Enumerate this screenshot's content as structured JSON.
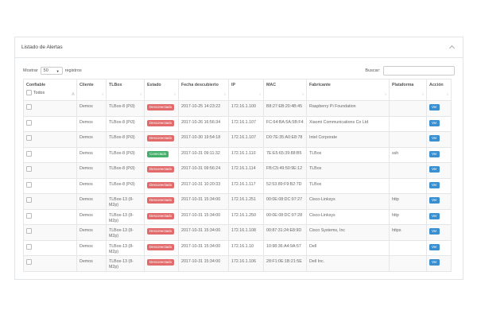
{
  "panel": {
    "title": "Listado de Alertas"
  },
  "controls": {
    "show_label": "Mostrar",
    "page_size": "50",
    "records_label": "registros",
    "search_label": "Buscar:"
  },
  "table": {
    "headers": {
      "trusted": "Confiable",
      "all": "Todos",
      "client": "Cliente",
      "tlbox": "TLBox",
      "status": "Estado",
      "discovered": "Fecha descubierto",
      "ip": "IP",
      "mac": "MAC",
      "maker": "Fabricante",
      "platform": "Plataforma",
      "action": "Acción"
    },
    "rows": [
      {
        "client": "Demos",
        "tlbox": "TLBox-8 (Pi3)",
        "status": "Desconectado",
        "status_kind": "red",
        "date": "2017-10-25 14:23:22",
        "ip": "172.16.1.100",
        "mac": "B8:27:EB:20:4B:45",
        "maker": "Raspberry Pi Foundation",
        "platform": "",
        "action": "Ver"
      },
      {
        "client": "Demos",
        "tlbox": "TLBox-8 (Pi3)",
        "status": "Desconectado",
        "status_kind": "red",
        "date": "2017-10-26 16:56:34",
        "ip": "172.16.1.107",
        "mac": "FC:64:BA:5A:5B:F4",
        "maker": "Xiaomi Communications Co Ltd",
        "platform": "",
        "action": "Ver"
      },
      {
        "client": "Demos",
        "tlbox": "TLBox-8 (Pi3)",
        "status": "Desconectado",
        "status_kind": "red",
        "date": "2017-10-30 19:54:18",
        "ip": "172.16.1.107",
        "mac": "D0:7E:35:A0:E8:78",
        "maker": "Intel Corporate",
        "platform": "",
        "action": "Ver"
      },
      {
        "client": "Demos",
        "tlbox": "TLBox-8 (Pi3)",
        "status": "Conectado",
        "status_kind": "green",
        "date": "2017-10-31 09:11:32",
        "ip": "172.16.1.110",
        "mac": "7E:E5:65:39:88:B5",
        "maker": "TLBox",
        "platform": "ssh",
        "action": "Ver"
      },
      {
        "client": "Demos",
        "tlbox": "TLBox-8 (Pi3)",
        "status": "Desconectado",
        "status_kind": "red",
        "date": "2017-10-31 09:56:24",
        "ip": "172.16.1.114",
        "mac": "FB:C5:49:50:9E:12",
        "maker": "TLBox",
        "platform": "",
        "action": "Ver"
      },
      {
        "client": "Demos",
        "tlbox": "TLBox-8 (Pi3)",
        "status": "Desconectado",
        "status_kind": "red",
        "date": "2017-10-31 10:20:33",
        "ip": "172.16.1.117",
        "mac": "52:53:89:F9:B2:7D",
        "maker": "TLBox",
        "platform": "",
        "action": "Ver"
      },
      {
        "client": "Demos",
        "tlbox": "TLBox-13 (8-M2p)",
        "status": "Desconectado",
        "status_kind": "red",
        "date": "2017-10-31 15:34:00",
        "ip": "172.16.1.251",
        "mac": "00:0E:08:DC:97:27",
        "maker": "Cisco-Linksys",
        "platform": "http",
        "action": "Ver"
      },
      {
        "client": "Demos",
        "tlbox": "TLBox-13 (8-M2p)",
        "status": "Desconectado",
        "status_kind": "red",
        "date": "2017-10-31 15:34:00",
        "ip": "172.16.1.250",
        "mac": "00:0E:08:DC:97:28",
        "maker": "Cisco-Linksys",
        "platform": "http",
        "action": "Ver"
      },
      {
        "client": "Demos",
        "tlbox": "TLBox-13 (8-M2p)",
        "status": "Desconectado",
        "status_kind": "red",
        "date": "2017-10-31 15:34:00",
        "ip": "172.16.1.108",
        "mac": "00:87:31:24:E8:9D",
        "maker": "Cisco Systems, Inc",
        "platform": "https",
        "action": "Ver"
      },
      {
        "client": "Demos",
        "tlbox": "TLBox-13 (8-M2p)",
        "status": "Desconectado",
        "status_kind": "red",
        "date": "2017-10-31 15:34:00",
        "ip": "172.16.1.10",
        "mac": "10:98:36:A4:9A:57",
        "maker": "Dell",
        "platform": "",
        "action": "Ver"
      },
      {
        "client": "Demos",
        "tlbox": "TLBox-13 (8-M2p)",
        "status": "Desconectado",
        "status_kind": "red",
        "date": "2017-10-31 15:34:00",
        "ip": "172.16.1.106",
        "mac": "28:F1:0E:1B:21:5E",
        "maker": "Dell Inc.",
        "platform": "",
        "action": "Ver"
      }
    ]
  },
  "colors": {
    "status_red": "#e26a6a",
    "status_green": "#45b06b",
    "action_blue": "#3a8fd1"
  }
}
